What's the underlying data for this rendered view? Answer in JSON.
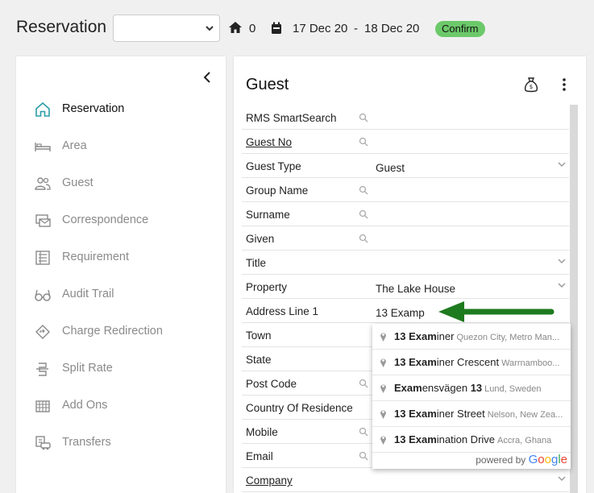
{
  "header": {
    "title": "Reservation",
    "select_value": "",
    "home_count": "0",
    "date_from": "17 Dec 20",
    "date_separator": "-",
    "date_to": "18 Dec 20",
    "status_badge": "Confirm",
    "badge_color": "#6cc96a"
  },
  "sidebar": {
    "items": [
      {
        "label": "Reservation",
        "icon": "home-icon",
        "active": true
      },
      {
        "label": "Area",
        "icon": "bed-icon"
      },
      {
        "label": "Guest",
        "icon": "people-icon"
      },
      {
        "label": "Correspondence",
        "icon": "mail-icon"
      },
      {
        "label": "Requirement",
        "icon": "list-icon"
      },
      {
        "label": "Audit Trail",
        "icon": "glasses-icon"
      },
      {
        "label": "Charge Redirection",
        "icon": "diamond-arrow-icon"
      },
      {
        "label": "Split Rate",
        "icon": "split-icon"
      },
      {
        "label": "Add Ons",
        "icon": "addons-icon"
      },
      {
        "label": "Transfers",
        "icon": "transfer-icon"
      }
    ]
  },
  "panel": {
    "title": "Guest",
    "fields": [
      {
        "label": "RMS SmartSearch",
        "value": "",
        "search": true
      },
      {
        "label": "Guest No",
        "value": "",
        "search": true,
        "link": true
      },
      {
        "label": "Guest Type",
        "value": "Guest",
        "dropdown": true
      },
      {
        "label": "Group Name",
        "value": "",
        "search": true
      },
      {
        "label": "Surname",
        "value": "",
        "search": true
      },
      {
        "label": "Given",
        "value": "",
        "search": true
      },
      {
        "label": "Title",
        "value": "",
        "dropdown": true
      },
      {
        "label": "Property",
        "value": "The Lake House",
        "dropdown": true
      },
      {
        "label": "Address Line 1",
        "value": "13 Examp"
      },
      {
        "label": "Town",
        "value": ""
      },
      {
        "label": "State",
        "value": ""
      },
      {
        "label": "Post Code",
        "value": "",
        "search": true
      },
      {
        "label": "Country Of Residence",
        "value": ""
      },
      {
        "label": "Mobile",
        "value": "",
        "search": true
      },
      {
        "label": "Email",
        "value": "",
        "search": true
      },
      {
        "label": "Company",
        "value": "",
        "dropdown": true,
        "link": true
      }
    ]
  },
  "autocomplete": {
    "items": [
      {
        "bold": "13 Exam",
        "rest": "iner",
        "sub": "Quezon City, Metro Man..."
      },
      {
        "bold": "13 Exam",
        "rest": "iner Crescent",
        "sub": "Warrnamboo..."
      },
      {
        "bold": "Exam",
        "rest": "ensvägen ",
        "bold2": "13",
        "sub": "Lund, Sweden"
      },
      {
        "bold": "13 Exam",
        "rest": "iner Street",
        "sub": "Nelson, New Zea..."
      },
      {
        "bold": "13 Exam",
        "rest": "ination Drive",
        "sub": "Accra, Ghana"
      }
    ],
    "powered_by": "powered by",
    "brand": "Google"
  },
  "colors": {
    "active_icon": "#2a9da8",
    "inactive_icon": "#8a8a8a",
    "arrow": "#1e7a1e"
  }
}
